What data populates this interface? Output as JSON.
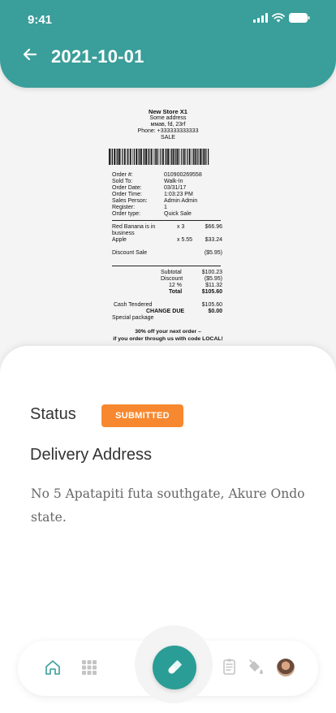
{
  "status_bar": {
    "time": "9:41"
  },
  "header": {
    "title": "2021-10-01"
  },
  "receipt": {
    "store_name": "New Store X1",
    "store_address_1": "Some address",
    "store_address_2": "ммав, fd, 23rf",
    "phone": "Phone: +333333333333",
    "type": "SALE",
    "order_info": [
      {
        "k": "Order #:",
        "v": "010900269558"
      },
      {
        "k": "Sold To:",
        "v": "Walk-In"
      },
      {
        "k": "Order Date:",
        "v": "03/31/17"
      },
      {
        "k": "Order Time:",
        "v": "1:03:23 PM"
      },
      {
        "k": "Sales Person:",
        "v": "Admin Admin"
      },
      {
        "k": "Register:",
        "v": "1"
      },
      {
        "k": "Order type:",
        "v": "Quick Sale"
      }
    ],
    "items": [
      {
        "name": "Red Banana is in business",
        "qty": "x 3",
        "amount": "$66.96"
      },
      {
        "name": "Apple",
        "qty": "x 5.55",
        "amount": "$33.24"
      },
      {
        "name": "Discount Sale",
        "qty": "",
        "amount": "($5.95)"
      }
    ],
    "subtotal_label": "Subtotal",
    "subtotal": "$100.23",
    "discount_label": "Discount",
    "discount": "($5.95)",
    "tax_label": "12 %",
    "tax": "$11.32",
    "total_label": "Total",
    "total": "$105.60",
    "cash_label": "Cash Tendered",
    "cash": "$105.60",
    "change_label": "CHANGE DUE",
    "change": "$0.00",
    "special": "Special package",
    "promo_1": "30% off your next order –",
    "promo_2": "if you order through us with code LOCAL!"
  },
  "details": {
    "status_label": "Status",
    "status_value": "SUBMITTED",
    "address_label": "Delivery Address",
    "address": "No 5 Apatapiti futa southgate, Akure Ondo state."
  },
  "colors": {
    "primary": "#3a9e9a",
    "badge": "#f7882f"
  },
  "nav": {
    "icons": [
      "home-icon",
      "grid-icon",
      "pill-icon",
      "document-icon",
      "paint-bucket-icon",
      "avatar"
    ]
  }
}
